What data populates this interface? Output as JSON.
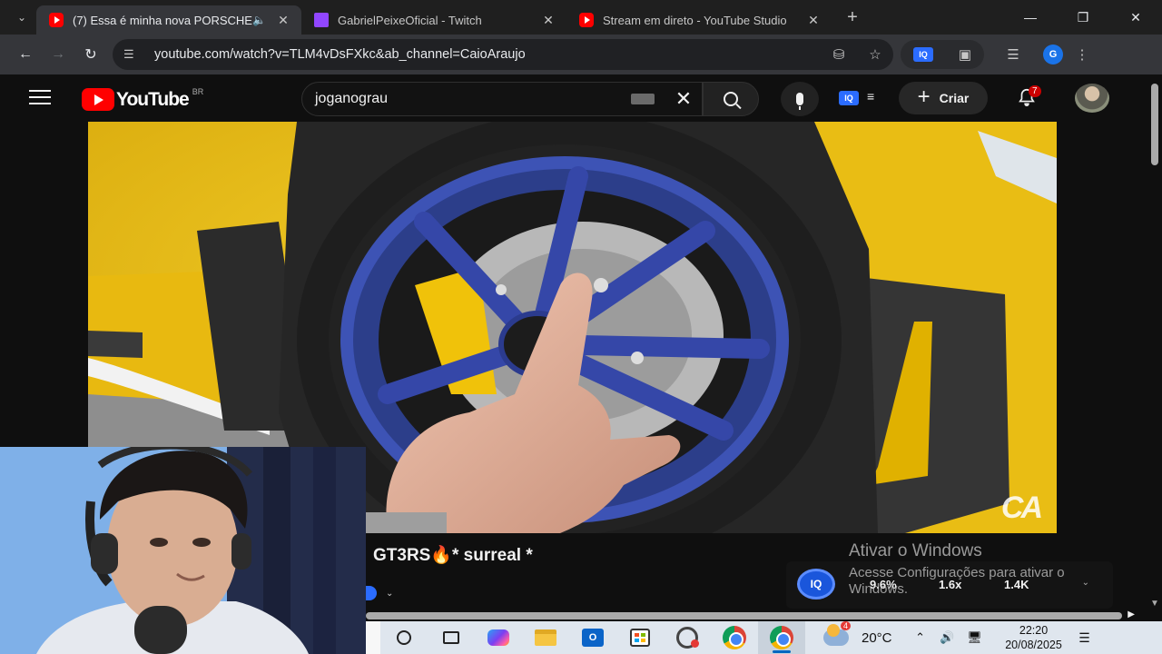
{
  "browser": {
    "tabs": [
      {
        "title": "(7) Essa é minha nova PORSCHE",
        "active": true,
        "favicon": "youtube-icon",
        "audio": true
      },
      {
        "title": "GabrielPeixeOficial - Twitch",
        "active": false,
        "favicon": "twitch-icon"
      },
      {
        "title": "Stream em direto - YouTube Studio",
        "active": false,
        "favicon": "youtube-icon"
      }
    ],
    "url": "youtube.com/watch?v=TLM4vDsFXkc&ab_channel=CaioAraujo"
  },
  "youtube": {
    "logo_text": "YouTube",
    "country": "BR",
    "search_query": "joganograu",
    "create_label": "Criar",
    "notifications_count": "7",
    "iq_badge": "IQ",
    "video": {
      "title": "GT3RS🔥* surreal *",
      "watermark": "CA"
    },
    "iq_panel": {
      "logo": "IQ",
      "stats": [
        "9.6%",
        "1.6x",
        "1.4K"
      ]
    }
  },
  "windows_activation": {
    "title": "Ativar o Windows",
    "message": "Acesse Configurações para ativar o Windows."
  },
  "taskbar": {
    "outlook_letter": "O",
    "temperature": "20°C",
    "weather_badge": "4",
    "time": "22:20",
    "date": "20/08/2025"
  },
  "colors": {
    "youtube_red": "#ff0000",
    "twitch_purple": "#9146ff",
    "iq_blue": "#2b6cff",
    "chrome_dark": "#35363a"
  }
}
